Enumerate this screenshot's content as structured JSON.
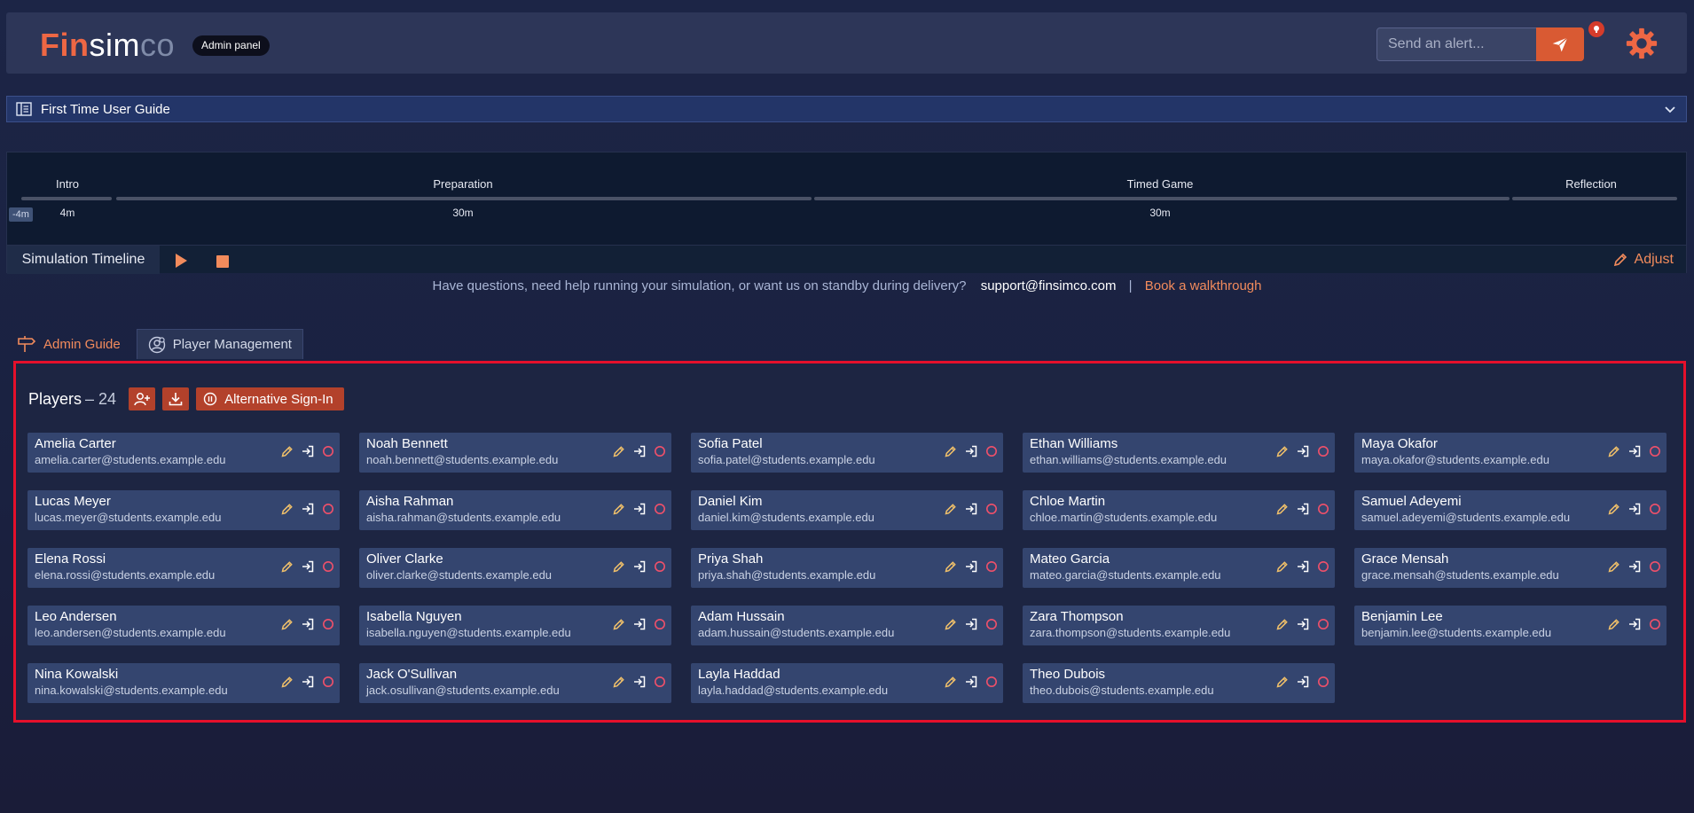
{
  "header": {
    "logo": {
      "fin": "Fin",
      "sim": "sim",
      "co": "co"
    },
    "badge": "Admin panel",
    "alert_placeholder": "Send an alert...",
    "accent": "#ee6744"
  },
  "guide": {
    "title": "First Time User Guide"
  },
  "timeline": {
    "offset": "-4m",
    "phases": [
      {
        "label": "Intro",
        "duration": "4m"
      },
      {
        "label": "Preparation",
        "duration": "30m"
      },
      {
        "label": "Timed Game",
        "duration": "30m"
      },
      {
        "label": "Reflection",
        "duration": ""
      }
    ],
    "footer_label": "Simulation Timeline",
    "adjust_label": "Adjust"
  },
  "help": {
    "question": "Have questions, need help running your simulation, or want us on standby during delivery?",
    "support": "support@finsimco.com",
    "separator": "|",
    "book": "Book a walkthrough"
  },
  "tabs": [
    {
      "label": "Admin Guide"
    },
    {
      "label": "Player Management"
    }
  ],
  "players": {
    "title": "Players",
    "count": "– 24",
    "alt_signin": "Alternative Sign-In",
    "list": [
      {
        "name": "Amelia Carter",
        "email": "amelia.carter@students.example.edu"
      },
      {
        "name": "Noah Bennett",
        "email": "noah.bennett@students.example.edu"
      },
      {
        "name": "Sofia Patel",
        "email": "sofia.patel@students.example.edu"
      },
      {
        "name": "Ethan Williams",
        "email": "ethan.williams@students.example.edu"
      },
      {
        "name": "Maya Okafor",
        "email": "maya.okafor@students.example.edu"
      },
      {
        "name": "Lucas Meyer",
        "email": "lucas.meyer@students.example.edu"
      },
      {
        "name": "Aisha Rahman",
        "email": "aisha.rahman@students.example.edu"
      },
      {
        "name": "Daniel Kim",
        "email": "daniel.kim@students.example.edu"
      },
      {
        "name": "Chloe Martin",
        "email": "chloe.martin@students.example.edu"
      },
      {
        "name": "Samuel Adeyemi",
        "email": "samuel.adeyemi@students.example.edu"
      },
      {
        "name": "Elena Rossi",
        "email": "elena.rossi@students.example.edu"
      },
      {
        "name": "Oliver Clarke",
        "email": "oliver.clarke@students.example.edu"
      },
      {
        "name": "Priya Shah",
        "email": "priya.shah@students.example.edu"
      },
      {
        "name": "Mateo Garcia",
        "email": "mateo.garcia@students.example.edu"
      },
      {
        "name": "Grace Mensah",
        "email": "grace.mensah@students.example.edu"
      },
      {
        "name": "Leo Andersen",
        "email": "leo.andersen@students.example.edu"
      },
      {
        "name": "Isabella Nguyen",
        "email": "isabella.nguyen@students.example.edu"
      },
      {
        "name": "Adam Hussain",
        "email": "adam.hussain@students.example.edu"
      },
      {
        "name": "Zara Thompson",
        "email": "zara.thompson@students.example.edu"
      },
      {
        "name": "Benjamin Lee",
        "email": "benjamin.lee@students.example.edu"
      },
      {
        "name": "Nina Kowalski",
        "email": "nina.kowalski@students.example.edu"
      },
      {
        "name": "Jack O'Sullivan",
        "email": "jack.osullivan@students.example.edu"
      },
      {
        "name": "Layla Haddad",
        "email": "layla.haddad@students.example.edu"
      },
      {
        "name": "Theo Dubois",
        "email": "theo.dubois@students.example.edu"
      }
    ]
  }
}
